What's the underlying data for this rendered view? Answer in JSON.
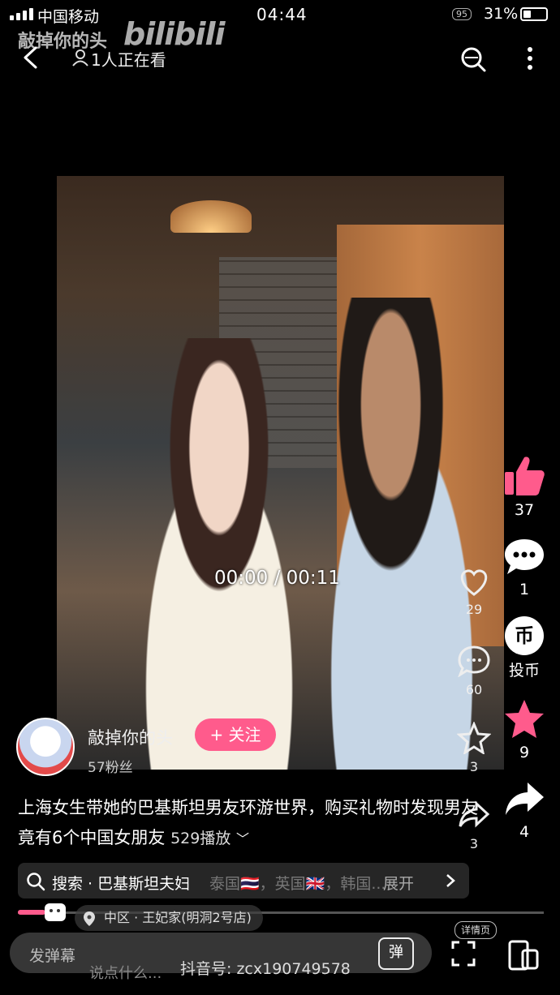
{
  "status_bar": {
    "carrier": "中国移动",
    "time": "04:44",
    "battery_level": "95",
    "battery_percent": "31%"
  },
  "header": {
    "watermark_title": "敲掉你的头",
    "watermark_logo": "bilibili",
    "viewers": "1人正在看"
  },
  "video": {
    "timecode": "00:00 / 00:11",
    "inner_like_count": "29",
    "inner_comment_count": "60",
    "inner_star_count": "3",
    "inner_share_count": "3"
  },
  "rail": {
    "like_count": "37",
    "comment_count": "1",
    "coin_label": "投币",
    "coin_glyph": "币",
    "favorite_count": "9",
    "share_count": "4"
  },
  "author": {
    "name": "敲掉你的头",
    "follow_label": "+ 关注",
    "fans": "57粉丝"
  },
  "description": {
    "text": "上海女生带她的巴基斯坦男友环游世界，购买礼物时发现男友竟有6个中国女朋友",
    "plays": "529播放"
  },
  "search": {
    "text": "搜索 · 巴基斯坦夫妇",
    "more": "展开",
    "ghost_text": "泰国🇹🇭，英国🇬🇧，韩国..."
  },
  "location": "中区 · 王妃家(明洞2号店)",
  "detail_label": "详情页",
  "bottom": {
    "danmu_placeholder": "发弹幕",
    "danmu_toggle": "弹",
    "ghost_input": "说点什么...",
    "douyin_id": "抖音号: zcx190749578"
  },
  "colors": {
    "accent_pink": "#ff5b8c"
  },
  "icons": [
    "back-icon",
    "search-scan-icon",
    "more-icon",
    "thumb-up-icon",
    "comment-icon",
    "coin-icon",
    "star-icon",
    "share-icon",
    "heart-icon",
    "fullscreen-icon",
    "portrait-icon",
    "location-icon",
    "search-icon",
    "chevron-right-icon"
  ]
}
